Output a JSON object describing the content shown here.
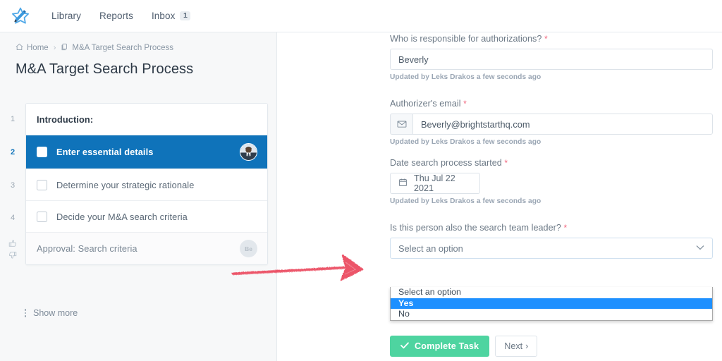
{
  "nav": {
    "logo_name": "process-star-logo",
    "items": [
      {
        "label": "Library"
      },
      {
        "label": "Reports"
      },
      {
        "label": "Inbox",
        "badge": "1"
      }
    ]
  },
  "breadcrumb": {
    "home": "Home",
    "separator": "›",
    "current": "M&A Target Search Process"
  },
  "page": {
    "title": "M&A Target Search Process",
    "show_more": "Show more"
  },
  "tasks": [
    {
      "number": "1",
      "label": "Introduction:",
      "type": "heading"
    },
    {
      "number": "2",
      "label": "Enter essential details",
      "type": "active",
      "avatar": "user-photo"
    },
    {
      "number": "3",
      "label": "Determine your strategic rationale",
      "type": "normal"
    },
    {
      "number": "4",
      "label": "Decide your M&A search criteria",
      "type": "normal"
    },
    {
      "number": "",
      "label": "Approval: Search criteria",
      "type": "approval",
      "avatar_initials": "Be"
    }
  ],
  "form": {
    "fields": [
      {
        "label": "Who is responsible for authorizations?",
        "required": "*",
        "value": "Beverly",
        "helper": "Updated by Leks Drakos a few seconds ago"
      },
      {
        "label": "Authorizer's email",
        "required": "*",
        "value": "Beverly@brightstarthq.com",
        "helper": "Updated by Leks Drakos a few seconds ago",
        "addon_icon": "envelope-icon"
      },
      {
        "label": "Date search process started",
        "required": "*",
        "value": "Thu Jul 22 2021",
        "helper": "Updated by Leks Drakos a few seconds ago",
        "icon": "calendar-icon"
      },
      {
        "label": "Is this person also the search team leader?",
        "required": "*",
        "value": "Select an option"
      }
    ],
    "dropdown": {
      "open": true,
      "options": [
        "Select an option",
        "Yes",
        "No"
      ],
      "highlighted": "Yes",
      "highlight_color": "#1e90ff"
    },
    "second_select_value": "Select an option"
  },
  "buttons": {
    "complete": "Complete Task",
    "complete_color": "#4ed4a0",
    "next": "Next",
    "next_chevron": "›"
  },
  "annotation": {
    "type": "red-arrow",
    "color": "#ec5569"
  },
  "colors": {
    "active_task": "#0f73ba",
    "panel_bg": "#f7f8f9",
    "required_star": "#f1647c"
  }
}
